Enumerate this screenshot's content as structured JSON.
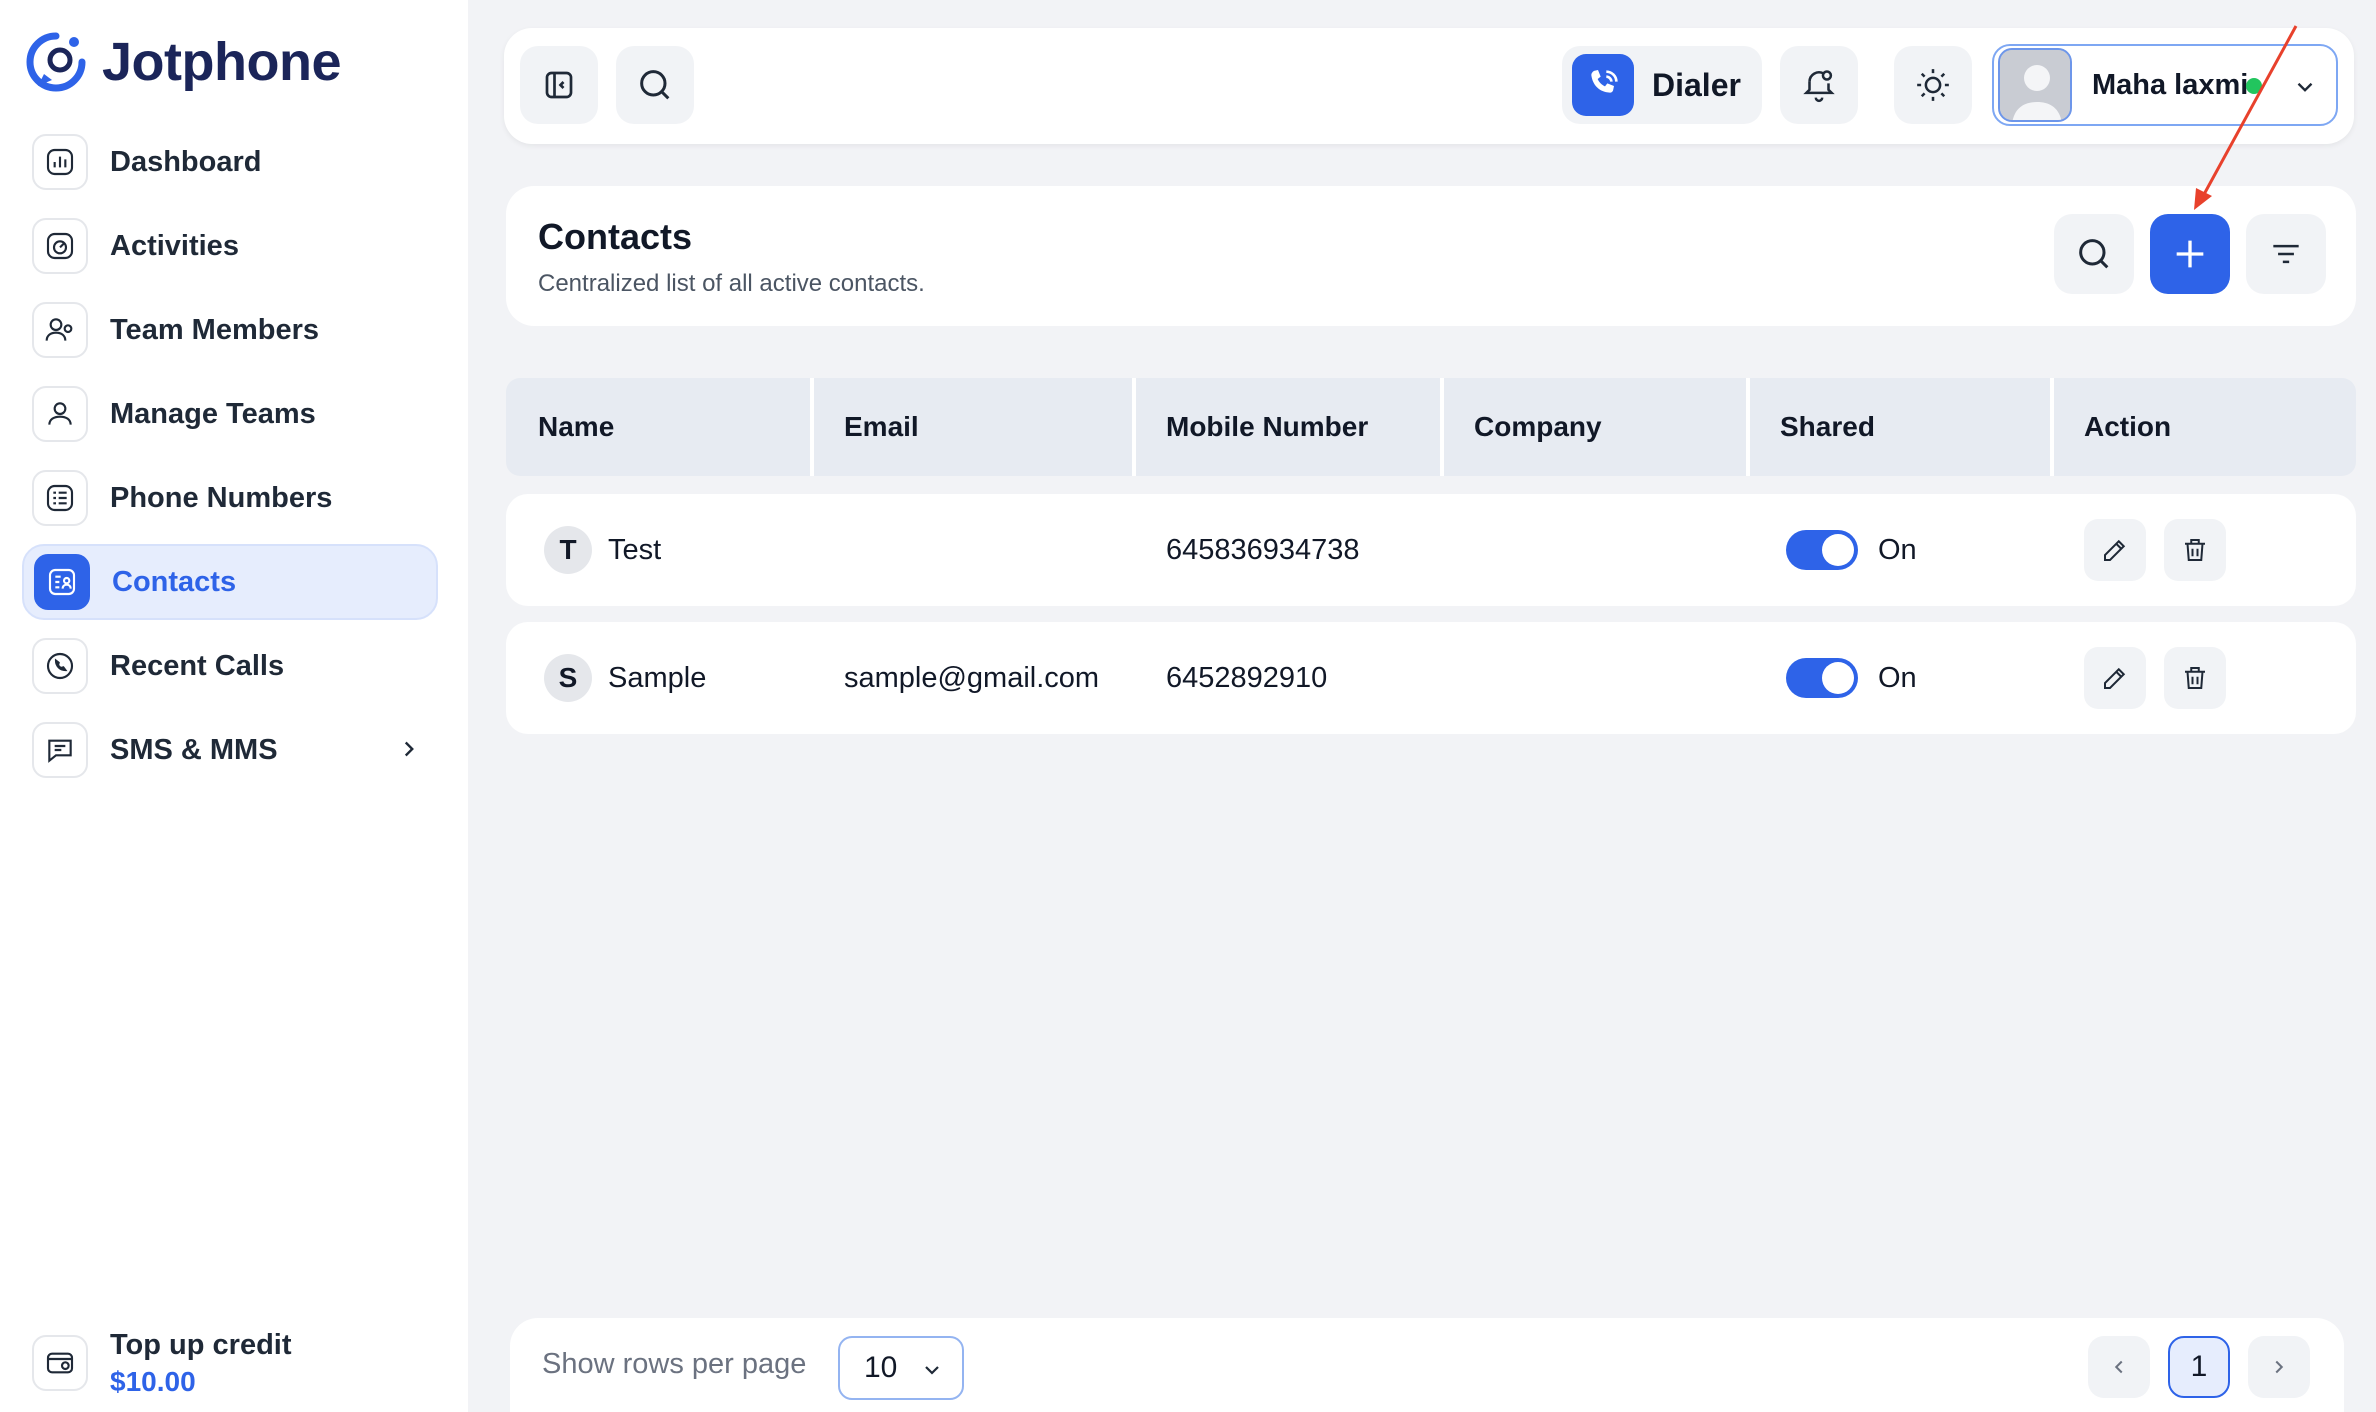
{
  "app": {
    "name": "Jotphone"
  },
  "sidebar": {
    "items": [
      {
        "label": "Dashboard",
        "icon": "chart-icon",
        "active": false
      },
      {
        "label": "Activities",
        "icon": "activity-icon",
        "active": false
      },
      {
        "label": "Team Members",
        "icon": "team-members-icon",
        "active": false
      },
      {
        "label": "Manage Teams",
        "icon": "users-icon",
        "active": false
      },
      {
        "label": "Phone Numbers",
        "icon": "phone-list-icon",
        "active": false
      },
      {
        "label": "Contacts",
        "icon": "contacts-icon",
        "active": true
      },
      {
        "label": "Recent Calls",
        "icon": "phone-call-icon",
        "active": false
      },
      {
        "label": "SMS & MMS",
        "icon": "message-icon",
        "active": false,
        "has_submenu": true
      }
    ],
    "topup": {
      "label": "Top up credit",
      "amount": "$10.00",
      "icon": "wallet-icon"
    }
  },
  "topbar": {
    "dialer_label": "Dialer",
    "user_name": "Maha laxmi",
    "user_status": "online",
    "status_color": "#22c55e"
  },
  "page": {
    "title": "Contacts",
    "subtitle": "Centralized list of all active contacts."
  },
  "table": {
    "columns": [
      "Name",
      "Email",
      "Mobile Number",
      "Company",
      "Shared",
      "Action"
    ],
    "rows": [
      {
        "initial": "T",
        "name": "Test",
        "email": "",
        "mobile": "645836934738",
        "company": "",
        "shared": true,
        "shared_label": "On"
      },
      {
        "initial": "S",
        "name": "Sample",
        "email": "sample@gmail.com",
        "mobile": "6452892910",
        "company": "",
        "shared": true,
        "shared_label": "On"
      }
    ]
  },
  "pagination": {
    "rows_label": "Show rows per page",
    "rows_per_page": "10",
    "current_page": "1"
  },
  "colors": {
    "accent": "#2e63e8",
    "annotation_arrow": "#e8412c"
  }
}
